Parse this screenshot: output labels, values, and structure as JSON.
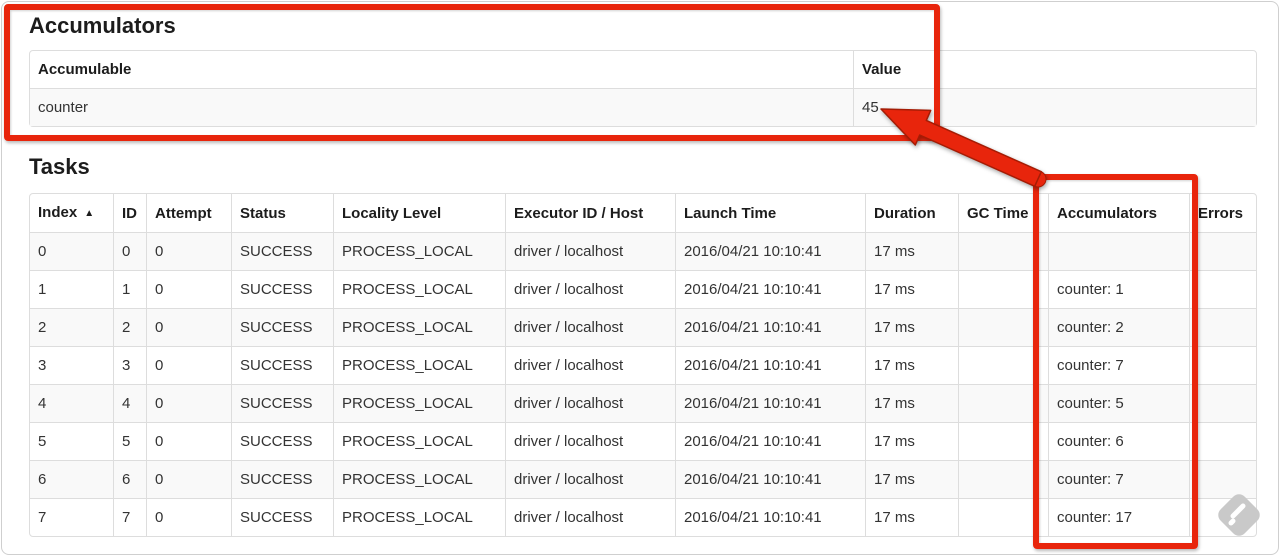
{
  "accumulators_section": {
    "title": "Accumulators",
    "table": {
      "headers": [
        "Accumulable",
        "Value"
      ],
      "rows": [
        {
          "accumulable": "counter",
          "value": "45"
        }
      ]
    }
  },
  "tasks_section": {
    "title": "Tasks",
    "table": {
      "headers": [
        "Index",
        "ID",
        "Attempt",
        "Status",
        "Locality Level",
        "Executor ID / Host",
        "Launch Time",
        "Duration",
        "GC Time",
        "Accumulators",
        "Errors"
      ],
      "sort_indicator": "▲",
      "rows": [
        {
          "index": "0",
          "id": "0",
          "attempt": "0",
          "status": "SUCCESS",
          "locality": "PROCESS_LOCAL",
          "executor": "driver / localhost",
          "launch": "2016/04/21 10:10:41",
          "duration": "17 ms",
          "gc": "",
          "accum": "",
          "errors": ""
        },
        {
          "index": "1",
          "id": "1",
          "attempt": "0",
          "status": "SUCCESS",
          "locality": "PROCESS_LOCAL",
          "executor": "driver / localhost",
          "launch": "2016/04/21 10:10:41",
          "duration": "17 ms",
          "gc": "",
          "accum": "counter: 1",
          "errors": ""
        },
        {
          "index": "2",
          "id": "2",
          "attempt": "0",
          "status": "SUCCESS",
          "locality": "PROCESS_LOCAL",
          "executor": "driver / localhost",
          "launch": "2016/04/21 10:10:41",
          "duration": "17 ms",
          "gc": "",
          "accum": "counter: 2",
          "errors": ""
        },
        {
          "index": "3",
          "id": "3",
          "attempt": "0",
          "status": "SUCCESS",
          "locality": "PROCESS_LOCAL",
          "executor": "driver / localhost",
          "launch": "2016/04/21 10:10:41",
          "duration": "17 ms",
          "gc": "",
          "accum": "counter: 7",
          "errors": ""
        },
        {
          "index": "4",
          "id": "4",
          "attempt": "0",
          "status": "SUCCESS",
          "locality": "PROCESS_LOCAL",
          "executor": "driver / localhost",
          "launch": "2016/04/21 10:10:41",
          "duration": "17 ms",
          "gc": "",
          "accum": "counter: 5",
          "errors": ""
        },
        {
          "index": "5",
          "id": "5",
          "attempt": "0",
          "status": "SUCCESS",
          "locality": "PROCESS_LOCAL",
          "executor": "driver / localhost",
          "launch": "2016/04/21 10:10:41",
          "duration": "17 ms",
          "gc": "",
          "accum": "counter: 6",
          "errors": ""
        },
        {
          "index": "6",
          "id": "6",
          "attempt": "0",
          "status": "SUCCESS",
          "locality": "PROCESS_LOCAL",
          "executor": "driver / localhost",
          "launch": "2016/04/21 10:10:41",
          "duration": "17 ms",
          "gc": "",
          "accum": "counter: 7",
          "errors": ""
        },
        {
          "index": "7",
          "id": "7",
          "attempt": "0",
          "status": "SUCCESS",
          "locality": "PROCESS_LOCAL",
          "executor": "driver / localhost",
          "launch": "2016/04/21 10:10:41",
          "duration": "17 ms",
          "gc": "",
          "accum": "counter: 17",
          "errors": ""
        }
      ]
    }
  },
  "annotations": {
    "red": "#e8250c",
    "red_outline": "#a51c05",
    "watermark_gray": "#c9c9c9"
  }
}
